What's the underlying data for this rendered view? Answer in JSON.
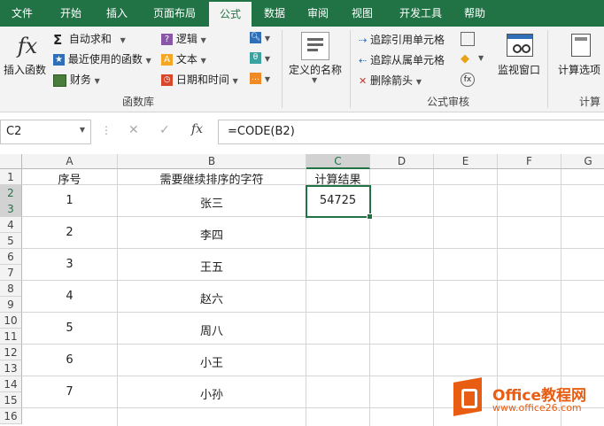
{
  "tabs": [
    "文件",
    "开始",
    "插入",
    "页面布局",
    "公式",
    "数据",
    "审阅",
    "视图",
    "开发工具",
    "帮助"
  ],
  "ribbon": {
    "insert_function": "插入函数",
    "autosum": "自动求和",
    "recent": "最近使用的函数",
    "financial": "财务",
    "logical": "逻辑",
    "text": "文本",
    "datetime": "日期和时间",
    "group_library": "函数库",
    "defined_names": "定义的名称",
    "trace_precedents": "追踪引用单元格",
    "trace_dependents": "追踪从属单元格",
    "remove_arrows": "删除箭头",
    "group_audit": "公式审核",
    "watch_window": "监视窗口",
    "calc_options": "计算选项",
    "group_calc": "计算"
  },
  "formula_bar": {
    "name_box": "C2",
    "fx": "fx",
    "formula": "=CODE(B2)"
  },
  "columns": [
    "A",
    "B",
    "C",
    "D",
    "E",
    "F",
    "G"
  ],
  "rows": [
    "1",
    "2",
    "3",
    "4",
    "5",
    "6",
    "7",
    "8",
    "9",
    "10",
    "11",
    "12",
    "13",
    "14",
    "15",
    "16"
  ],
  "sheet": {
    "headers": [
      "序号",
      "需要继续排序的字符",
      "计算结果"
    ],
    "records": [
      {
        "num": "1",
        "name": "张三",
        "result": "54725"
      },
      {
        "num": "2",
        "name": "李四",
        "result": ""
      },
      {
        "num": "3",
        "name": "王五",
        "result": ""
      },
      {
        "num": "4",
        "name": "赵六",
        "result": ""
      },
      {
        "num": "5",
        "name": "周八",
        "result": ""
      },
      {
        "num": "6",
        "name": "小王",
        "result": ""
      },
      {
        "num": "7",
        "name": "小孙",
        "result": ""
      }
    ]
  },
  "watermark": {
    "title": "Office教程网",
    "url": "www.office26.com"
  },
  "colors": {
    "excel_green": "#217346",
    "watermark_orange": "#e85d12"
  }
}
